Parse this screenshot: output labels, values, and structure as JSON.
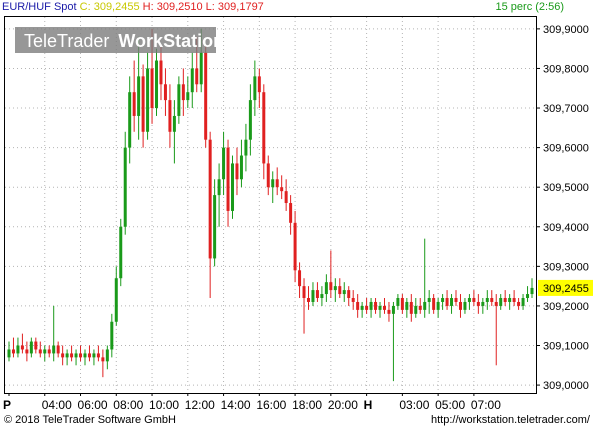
{
  "header": {
    "symbol": "EUR/HUF Spot",
    "close_label": "C:",
    "close_value": "309,2455",
    "high_label": "H:",
    "high_value": "309,2510",
    "low_label": "L:",
    "low_value": "309,1797",
    "interval": "15 perc (2:56)"
  },
  "watermark": {
    "part1": "TeleTrader",
    "part2": "WorkStation"
  },
  "footer": {
    "copyright": "© 2018 TeleTrader Software GmbH",
    "url": "http://workstation.teletrader.com/"
  },
  "colors": {
    "up": "#1a9a1a",
    "down": "#e02020",
    "grid": "#b4b4b4",
    "last_price_bg": "#ffff00",
    "header_close": "#c8c800",
    "header_hl": "#e02020",
    "header_interval": "#1a9a1a"
  },
  "chart_data": {
    "type": "candlestick",
    "title": "EUR/HUF Spot",
    "interval": "15 perc",
    "x_tick_labels": [
      "P",
      "04:00",
      "06:00",
      "08:00",
      "10:00",
      "12:00",
      "14:00",
      "16:00",
      "18:00",
      "20:00",
      "H",
      "03:00",
      "05:00",
      "07:00"
    ],
    "y_tick_labels": [
      "309,9000",
      "309,8000",
      "309,7000",
      "309,6000",
      "309,5000",
      "309,4000",
      "309,3000",
      "309,2000",
      "309,1000",
      "309,0000"
    ],
    "ylim": [
      308.98,
      309.93
    ],
    "last_price": 309.2455,
    "last_price_label": "309,2455",
    "grid": true,
    "up_color": "green",
    "down_color": "red",
    "candles": [
      {
        "t": "03:00",
        "o": 309.07,
        "h": 309.11,
        "l": 309.06,
        "c": 309.09
      },
      {
        "t": "03:15",
        "o": 309.09,
        "h": 309.12,
        "l": 309.07,
        "c": 309.08
      },
      {
        "t": "03:30",
        "o": 309.08,
        "h": 309.12,
        "l": 309.07,
        "c": 309.1
      },
      {
        "t": "03:45",
        "o": 309.1,
        "h": 309.13,
        "l": 309.08,
        "c": 309.09
      },
      {
        "t": "04:00",
        "o": 309.09,
        "h": 309.11,
        "l": 309.06,
        "c": 309.08
      },
      {
        "t": "04:15",
        "o": 309.08,
        "h": 309.12,
        "l": 309.07,
        "c": 309.11
      },
      {
        "t": "04:30",
        "o": 309.11,
        "h": 309.12,
        "l": 309.08,
        "c": 309.09
      },
      {
        "t": "04:45",
        "o": 309.09,
        "h": 309.11,
        "l": 309.07,
        "c": 309.08
      },
      {
        "t": "05:00",
        "o": 309.08,
        "h": 309.1,
        "l": 309.06,
        "c": 309.09
      },
      {
        "t": "05:15",
        "o": 309.09,
        "h": 309.1,
        "l": 309.07,
        "c": 309.08
      },
      {
        "t": "05:30",
        "o": 309.08,
        "h": 309.2,
        "l": 309.06,
        "c": 309.1
      },
      {
        "t": "05:45",
        "o": 309.1,
        "h": 309.11,
        "l": 309.07,
        "c": 309.08
      },
      {
        "t": "06:00",
        "o": 309.08,
        "h": 309.1,
        "l": 309.05,
        "c": 309.07
      },
      {
        "t": "06:15",
        "o": 309.07,
        "h": 309.09,
        "l": 309.05,
        "c": 309.08
      },
      {
        "t": "06:30",
        "o": 309.08,
        "h": 309.1,
        "l": 309.06,
        "c": 309.07
      },
      {
        "t": "06:45",
        "o": 309.07,
        "h": 309.09,
        "l": 309.05,
        "c": 309.08
      },
      {
        "t": "07:00",
        "o": 309.08,
        "h": 309.1,
        "l": 309.06,
        "c": 309.07
      },
      {
        "t": "07:15",
        "o": 309.07,
        "h": 309.09,
        "l": 309.05,
        "c": 309.08
      },
      {
        "t": "07:30",
        "o": 309.08,
        "h": 309.1,
        "l": 309.06,
        "c": 309.07
      },
      {
        "t": "07:45",
        "o": 309.07,
        "h": 309.09,
        "l": 309.05,
        "c": 309.08
      },
      {
        "t": "08:00",
        "o": 309.08,
        "h": 309.1,
        "l": 309.06,
        "c": 309.07
      },
      {
        "t": "08:15",
        "o": 309.07,
        "h": 309.09,
        "l": 309.02,
        "c": 309.06
      },
      {
        "t": "08:30",
        "o": 309.06,
        "h": 309.1,
        "l": 309.04,
        "c": 309.09
      },
      {
        "t": "08:45",
        "o": 309.09,
        "h": 309.18,
        "l": 309.07,
        "c": 309.16
      },
      {
        "t": "09:00",
        "o": 309.16,
        "h": 309.3,
        "l": 309.15,
        "c": 309.27
      },
      {
        "t": "09:15",
        "o": 309.27,
        "h": 309.42,
        "l": 309.25,
        "c": 309.4
      },
      {
        "t": "09:30",
        "o": 309.4,
        "h": 309.64,
        "l": 309.38,
        "c": 309.6
      },
      {
        "t": "09:45",
        "o": 309.6,
        "h": 309.78,
        "l": 309.56,
        "c": 309.74
      },
      {
        "t": "10:00",
        "o": 309.74,
        "h": 309.82,
        "l": 309.64,
        "c": 309.68
      },
      {
        "t": "10:15",
        "o": 309.68,
        "h": 309.88,
        "l": 309.62,
        "c": 309.78
      },
      {
        "t": "10:30",
        "o": 309.78,
        "h": 309.81,
        "l": 309.6,
        "c": 309.64
      },
      {
        "t": "10:45",
        "o": 309.64,
        "h": 309.84,
        "l": 309.62,
        "c": 309.8
      },
      {
        "t": "11:00",
        "o": 309.8,
        "h": 309.9,
        "l": 309.66,
        "c": 309.7
      },
      {
        "t": "11:15",
        "o": 309.7,
        "h": 309.85,
        "l": 309.68,
        "c": 309.82
      },
      {
        "t": "11:30",
        "o": 309.82,
        "h": 309.86,
        "l": 309.72,
        "c": 309.76
      },
      {
        "t": "11:45",
        "o": 309.76,
        "h": 309.8,
        "l": 309.68,
        "c": 309.72
      },
      {
        "t": "12:00",
        "o": 309.72,
        "h": 309.76,
        "l": 309.6,
        "c": 309.64
      },
      {
        "t": "12:15",
        "o": 309.64,
        "h": 309.72,
        "l": 309.56,
        "c": 309.68
      },
      {
        "t": "12:30",
        "o": 309.68,
        "h": 309.78,
        "l": 309.66,
        "c": 309.76
      },
      {
        "t": "12:45",
        "o": 309.76,
        "h": 309.8,
        "l": 309.68,
        "c": 309.72
      },
      {
        "t": "13:00",
        "o": 309.72,
        "h": 309.78,
        "l": 309.7,
        "c": 309.74
      },
      {
        "t": "13:15",
        "o": 309.74,
        "h": 309.84,
        "l": 309.7,
        "c": 309.8
      },
      {
        "t": "13:30",
        "o": 309.8,
        "h": 309.88,
        "l": 309.74,
        "c": 309.76
      },
      {
        "t": "13:45",
        "o": 309.76,
        "h": 309.9,
        "l": 309.74,
        "c": 309.84
      },
      {
        "t": "14:00",
        "o": 309.84,
        "h": 309.86,
        "l": 309.6,
        "c": 309.62
      },
      {
        "t": "14:15",
        "o": 309.62,
        "h": 309.64,
        "l": 309.22,
        "c": 309.32
      },
      {
        "t": "14:30",
        "o": 309.32,
        "h": 309.52,
        "l": 309.3,
        "c": 309.48
      },
      {
        "t": "14:45",
        "o": 309.48,
        "h": 309.56,
        "l": 309.4,
        "c": 309.52
      },
      {
        "t": "15:00",
        "o": 309.52,
        "h": 309.64,
        "l": 309.48,
        "c": 309.6
      },
      {
        "t": "15:15",
        "o": 309.6,
        "h": 309.62,
        "l": 309.4,
        "c": 309.44
      },
      {
        "t": "15:30",
        "o": 309.44,
        "h": 309.58,
        "l": 309.42,
        "c": 309.56
      },
      {
        "t": "15:45",
        "o": 309.56,
        "h": 309.6,
        "l": 309.48,
        "c": 309.52
      },
      {
        "t": "16:00",
        "o": 309.52,
        "h": 309.62,
        "l": 309.5,
        "c": 309.58
      },
      {
        "t": "16:15",
        "o": 309.58,
        "h": 309.66,
        "l": 309.54,
        "c": 309.62
      },
      {
        "t": "16:30",
        "o": 309.62,
        "h": 309.76,
        "l": 309.58,
        "c": 309.72
      },
      {
        "t": "16:45",
        "o": 309.72,
        "h": 309.82,
        "l": 309.68,
        "c": 309.78
      },
      {
        "t": "17:00",
        "o": 309.78,
        "h": 309.8,
        "l": 309.7,
        "c": 309.74
      },
      {
        "t": "17:15",
        "o": 309.74,
        "h": 309.76,
        "l": 309.52,
        "c": 309.56
      },
      {
        "t": "17:30",
        "o": 309.56,
        "h": 309.58,
        "l": 309.48,
        "c": 309.5
      },
      {
        "t": "17:45",
        "o": 309.5,
        "h": 309.54,
        "l": 309.46,
        "c": 309.52
      },
      {
        "t": "18:00",
        "o": 309.52,
        "h": 309.55,
        "l": 309.48,
        "c": 309.5
      },
      {
        "t": "18:15",
        "o": 309.5,
        "h": 309.53,
        "l": 309.47,
        "c": 309.49
      },
      {
        "t": "18:30",
        "o": 309.49,
        "h": 309.52,
        "l": 309.44,
        "c": 309.46
      },
      {
        "t": "18:45",
        "o": 309.46,
        "h": 309.48,
        "l": 309.38,
        "c": 309.41
      },
      {
        "t": "19:00",
        "o": 309.41,
        "h": 309.44,
        "l": 309.26,
        "c": 309.29
      },
      {
        "t": "19:15",
        "o": 309.29,
        "h": 309.31,
        "l": 309.22,
        "c": 309.25
      },
      {
        "t": "19:30",
        "o": 309.25,
        "h": 309.27,
        "l": 309.13,
        "c": 309.22
      },
      {
        "t": "19:45",
        "o": 309.22,
        "h": 309.25,
        "l": 309.19,
        "c": 309.21
      },
      {
        "t": "20:00",
        "o": 309.21,
        "h": 309.26,
        "l": 309.2,
        "c": 309.24
      },
      {
        "t": "20:15",
        "o": 309.24,
        "h": 309.26,
        "l": 309.21,
        "c": 309.22
      },
      {
        "t": "20:30",
        "o": 309.22,
        "h": 309.25,
        "l": 309.2,
        "c": 309.23
      },
      {
        "t": "20:45",
        "o": 309.23,
        "h": 309.28,
        "l": 309.21,
        "c": 309.26
      },
      {
        "t": "21:00",
        "o": 309.26,
        "h": 309.34,
        "l": 309.22,
        "c": 309.24
      },
      {
        "t": "21:15",
        "o": 309.24,
        "h": 309.27,
        "l": 309.21,
        "c": 309.25
      },
      {
        "t": "21:30",
        "o": 309.25,
        "h": 309.27,
        "l": 309.22,
        "c": 309.23
      },
      {
        "t": "21:45",
        "o": 309.23,
        "h": 309.26,
        "l": 309.21,
        "c": 309.24
      },
      {
        "t": "22:00",
        "o": 309.24,
        "h": 309.25,
        "l": 309.2,
        "c": 309.22
      },
      {
        "t": "22:15",
        "o": 309.22,
        "h": 309.24,
        "l": 309.19,
        "c": 309.21
      },
      {
        "t": "22:30",
        "o": 309.21,
        "h": 309.23,
        "l": 309.17,
        "c": 309.19
      },
      {
        "t": "22:45",
        "o": 309.19,
        "h": 309.21,
        "l": 309.17,
        "c": 309.2
      },
      {
        "t": "23:00",
        "o": 309.2,
        "h": 309.22,
        "l": 309.18,
        "c": 309.19
      },
      {
        "t": "23:15",
        "o": 309.19,
        "h": 309.22,
        "l": 309.17,
        "c": 309.21
      },
      {
        "t": "23:30",
        "o": 309.21,
        "h": 309.22,
        "l": 309.18,
        "c": 309.19
      },
      {
        "t": "23:45",
        "o": 309.19,
        "h": 309.21,
        "l": 309.17,
        "c": 309.2
      },
      {
        "t": "00:00",
        "o": 309.2,
        "h": 309.22,
        "l": 309.18,
        "c": 309.19
      },
      {
        "t": "00:15",
        "o": 309.19,
        "h": 309.21,
        "l": 309.16,
        "c": 309.18
      },
      {
        "t": "00:30",
        "o": 309.18,
        "h": 309.21,
        "l": 309.01,
        "c": 309.2
      },
      {
        "t": "00:45",
        "o": 309.2,
        "h": 309.23,
        "l": 309.19,
        "c": 309.22
      },
      {
        "t": "01:00",
        "o": 309.22,
        "h": 309.23,
        "l": 309.18,
        "c": 309.19
      },
      {
        "t": "01:15",
        "o": 309.19,
        "h": 309.22,
        "l": 309.17,
        "c": 309.21
      },
      {
        "t": "01:30",
        "o": 309.21,
        "h": 309.23,
        "l": 309.16,
        "c": 309.18
      },
      {
        "t": "01:45",
        "o": 309.18,
        "h": 309.22,
        "l": 309.17,
        "c": 309.2
      },
      {
        "t": "02:00",
        "o": 309.2,
        "h": 309.22,
        "l": 309.18,
        "c": 309.19
      },
      {
        "t": "02:15",
        "o": 309.19,
        "h": 309.37,
        "l": 309.17,
        "c": 309.21
      },
      {
        "t": "02:30",
        "o": 309.21,
        "h": 309.24,
        "l": 309.18,
        "c": 309.22
      },
      {
        "t": "02:45",
        "o": 309.22,
        "h": 309.23,
        "l": 309.18,
        "c": 309.19
      },
      {
        "t": "03:00",
        "o": 309.19,
        "h": 309.22,
        "l": 309.17,
        "c": 309.21
      },
      {
        "t": "03:15",
        "o": 309.21,
        "h": 309.23,
        "l": 309.19,
        "c": 309.22
      },
      {
        "t": "03:30",
        "o": 309.22,
        "h": 309.24,
        "l": 309.19,
        "c": 309.2
      },
      {
        "t": "03:45",
        "o": 309.2,
        "h": 309.23,
        "l": 309.18,
        "c": 309.22
      },
      {
        "t": "04:00",
        "o": 309.22,
        "h": 309.24,
        "l": 309.2,
        "c": 309.21
      },
      {
        "t": "04:15",
        "o": 309.21,
        "h": 309.23,
        "l": 309.17,
        "c": 309.19
      },
      {
        "t": "04:30",
        "o": 309.19,
        "h": 309.22,
        "l": 309.18,
        "c": 309.21
      },
      {
        "t": "04:45",
        "o": 309.21,
        "h": 309.23,
        "l": 309.19,
        "c": 309.22
      },
      {
        "t": "05:00",
        "o": 309.22,
        "h": 309.24,
        "l": 309.2,
        "c": 309.21
      },
      {
        "t": "05:15",
        "o": 309.21,
        "h": 309.23,
        "l": 309.18,
        "c": 309.2
      },
      {
        "t": "05:30",
        "o": 309.2,
        "h": 309.22,
        "l": 309.18,
        "c": 309.21
      },
      {
        "t": "05:45",
        "o": 309.21,
        "h": 309.24,
        "l": 309.19,
        "c": 309.22
      },
      {
        "t": "06:00",
        "o": 309.22,
        "h": 309.24,
        "l": 309.2,
        "c": 309.21
      },
      {
        "t": "06:15",
        "o": 309.21,
        "h": 309.23,
        "l": 309.05,
        "c": 309.2
      },
      {
        "t": "06:30",
        "o": 309.2,
        "h": 309.23,
        "l": 309.19,
        "c": 309.22
      },
      {
        "t": "06:45",
        "o": 309.22,
        "h": 309.24,
        "l": 309.2,
        "c": 309.21
      },
      {
        "t": "07:00",
        "o": 309.21,
        "h": 309.23,
        "l": 309.19,
        "c": 309.22
      },
      {
        "t": "07:15",
        "o": 309.22,
        "h": 309.24,
        "l": 309.2,
        "c": 309.21
      },
      {
        "t": "07:30",
        "o": 309.21,
        "h": 309.22,
        "l": 309.19,
        "c": 309.2
      },
      {
        "t": "07:45",
        "o": 309.2,
        "h": 309.23,
        "l": 309.19,
        "c": 309.22
      },
      {
        "t": "08:00",
        "o": 309.22,
        "h": 309.25,
        "l": 309.21,
        "c": 309.23
      },
      {
        "t": "08:15",
        "o": 309.23,
        "h": 309.27,
        "l": 309.22,
        "c": 309.2455
      }
    ]
  }
}
